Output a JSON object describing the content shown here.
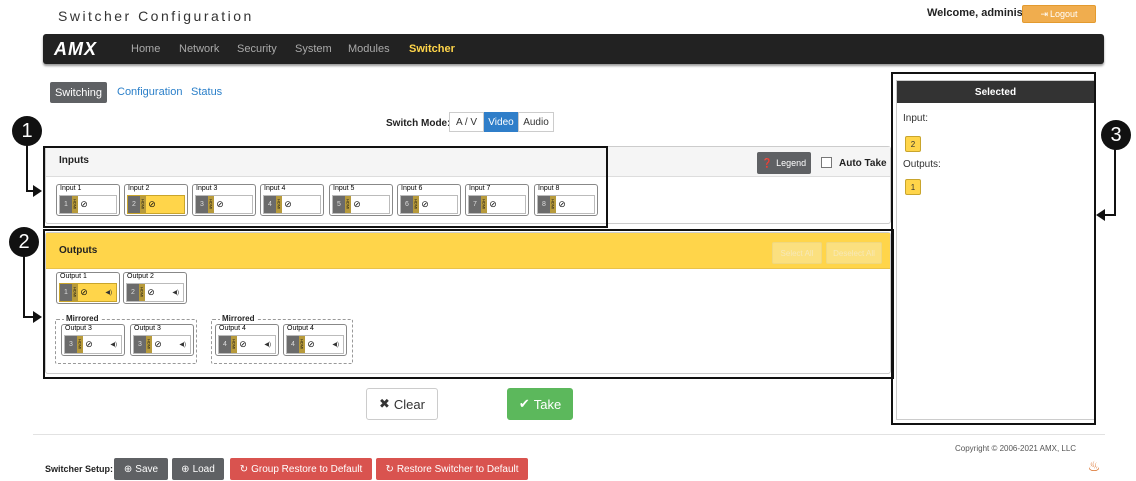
{
  "header": {
    "title": "Switcher Configuration",
    "welcome": "Welcome, administrator",
    "logout_label": "Logout"
  },
  "navbar": {
    "logo": "AMX",
    "items": [
      {
        "label": "Home"
      },
      {
        "label": "Network"
      },
      {
        "label": "Security"
      },
      {
        "label": "System"
      },
      {
        "label": "Modules"
      },
      {
        "label": "Switcher",
        "active": true
      }
    ]
  },
  "subtabs": [
    {
      "label": "Switching",
      "active": true
    },
    {
      "label": "Configuration"
    },
    {
      "label": "Status"
    }
  ],
  "switch_mode": {
    "label": "Switch Mode:",
    "options": [
      "A / V",
      "Video",
      "Audio"
    ],
    "selected": "Video"
  },
  "inputs_panel": {
    "title": "Inputs",
    "legend_label": "Legend",
    "auto_take_label": "Auto Take",
    "cards": [
      {
        "label": "Input 1",
        "num": "1",
        "tag": "HDMI"
      },
      {
        "label": "Input 2",
        "num": "2",
        "tag": "HDMI",
        "selected": true
      },
      {
        "label": "Input 3",
        "num": "3",
        "tag": "HDMI"
      },
      {
        "label": "Input 4",
        "num": "4",
        "tag": "HDMI"
      },
      {
        "label": "Input 5",
        "num": "5",
        "tag": "HDMI"
      },
      {
        "label": "Input 6",
        "num": "6",
        "tag": "HDMI"
      },
      {
        "label": "Input 7",
        "num": "7",
        "tag": "HDMI"
      },
      {
        "label": "Input 8",
        "num": "8",
        "tag": "HDMI"
      }
    ]
  },
  "outputs_panel": {
    "title": "Outputs",
    "select_all_label": "Select All",
    "deselect_all_label": "Deselect All",
    "cards": [
      {
        "label": "Output 1",
        "num": "1",
        "tag": "HDMI",
        "selected": true
      },
      {
        "label": "Output 2",
        "num": "2",
        "tag": "HDMI"
      }
    ],
    "mirrored_groups": [
      {
        "label": "Mirrored",
        "cards": [
          {
            "label": "Output 3",
            "num": "3",
            "tag": "HDMI"
          },
          {
            "label": "Output 3",
            "num": "3",
            "tag": "HDMI"
          }
        ]
      },
      {
        "label": "Mirrored",
        "cards": [
          {
            "label": "Output 4",
            "num": "4",
            "tag": "HDMI"
          },
          {
            "label": "Output 4",
            "num": "4",
            "tag": "HDMI"
          }
        ]
      }
    ]
  },
  "selected_panel": {
    "title": "Selected",
    "input_label": "Input:",
    "input_value": "2",
    "outputs_label": "Outputs:",
    "output_value": "1"
  },
  "actions": {
    "clear_label": "Clear",
    "take_label": "Take"
  },
  "callouts": [
    "1",
    "2",
    "3"
  ],
  "footer": {
    "copyright": "Copyright © 2006-2021 AMX, LLC",
    "setup_label": "Switcher Setup:",
    "save_label": "Save",
    "load_label": "Load",
    "group_restore_label": "Group Restore to Default",
    "restore_label": "Restore Switcher to Default"
  },
  "colors": {
    "accent_yellow": "#ffd54a",
    "take_green": "#5cb85c",
    "restore_red": "#d9534f",
    "nav_dark": "#222222",
    "link_blue": "#2a7fc9"
  }
}
